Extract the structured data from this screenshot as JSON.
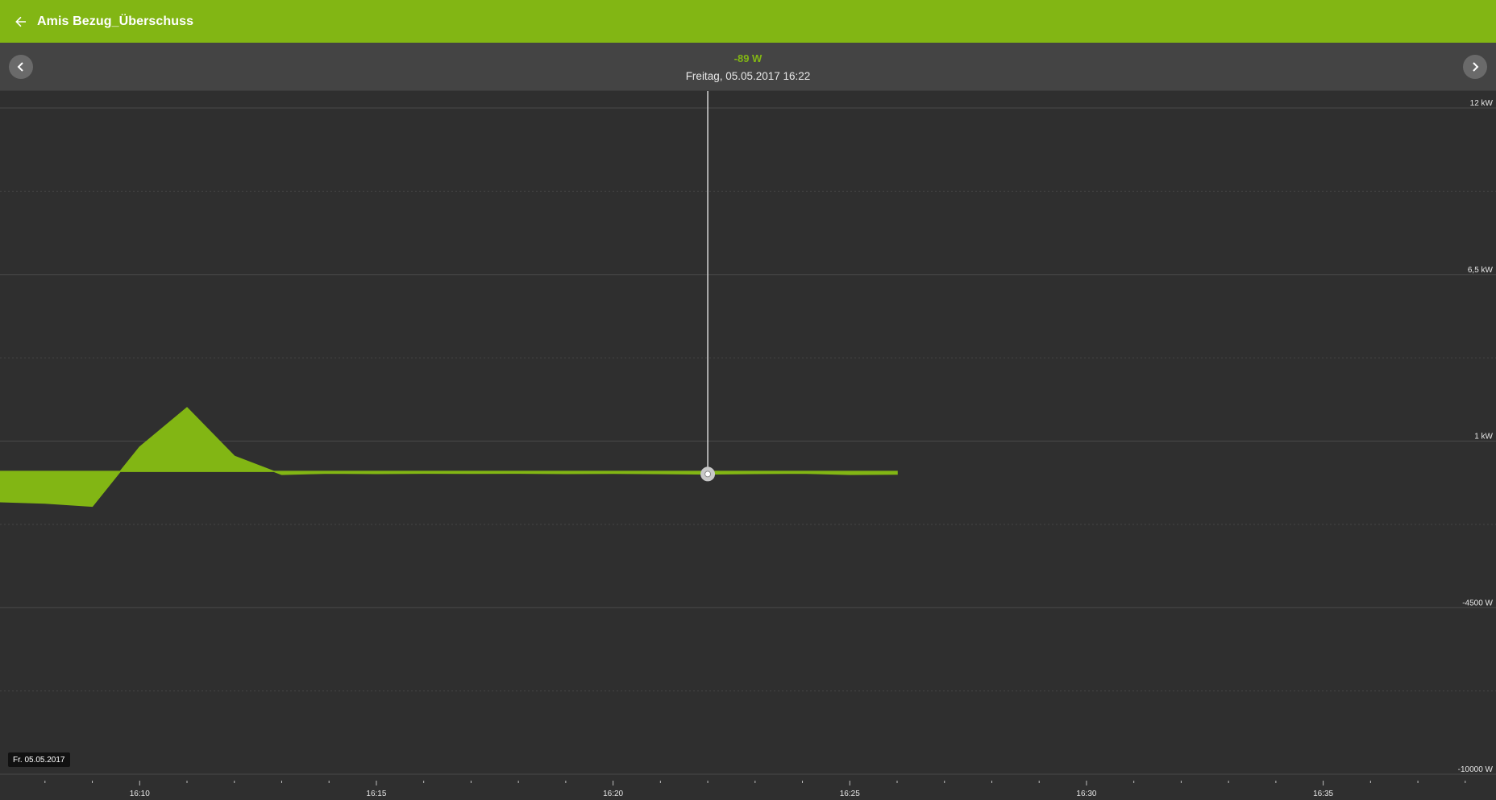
{
  "appbar": {
    "title": "Amis Bezug_Überschuss",
    "back_icon": "arrow-left-icon",
    "background": "#82b614"
  },
  "infobar": {
    "value": "-89 W",
    "datetime": "Freitag, 05.05.2017 16:22",
    "prev_icon": "chevron-left-icon",
    "next_icon": "chevron-right-icon",
    "value_color": "#82b614"
  },
  "date_chip": "Fr. 05.05.2017",
  "chart_data": {
    "type": "area",
    "y_unit": "W",
    "ylim": [
      -10000,
      12000
    ],
    "y_ticks": [
      {
        "value": 12000,
        "label": "12  kW"
      },
      {
        "value": 6500,
        "label": "6,5  kW"
      },
      {
        "value": 1000,
        "label": "1  kW"
      },
      {
        "value": -4500,
        "label": "-4500  W"
      },
      {
        "value": -10000,
        "label": "-10000  W"
      }
    ],
    "x_ticks": [
      {
        "minute": 10,
        "label": "16:10"
      },
      {
        "minute": 15,
        "label": "16:15"
      },
      {
        "minute": 20,
        "label": "16:20"
      },
      {
        "minute": 25,
        "label": "16:25"
      },
      {
        "minute": 30,
        "label": "16:30"
      },
      {
        "minute": 35,
        "label": "16:35"
      }
    ],
    "x_range_minutes": [
      7.05,
      38.65
    ],
    "x_time_base": "16:00",
    "series": [
      {
        "color": "#82b614",
        "points": [
          {
            "t": "16:07",
            "y": -1000
          },
          {
            "t": "16:08",
            "y": -1050
          },
          {
            "t": "16:09",
            "y": -1150
          },
          {
            "t": "16:10",
            "y": 800
          },
          {
            "t": "16:11",
            "y": 2100
          },
          {
            "t": "16:12",
            "y": 500
          },
          {
            "t": "16:13",
            "y": -100
          },
          {
            "t": "16:14",
            "y": -60
          },
          {
            "t": "16:15",
            "y": -70
          },
          {
            "t": "16:16",
            "y": -60
          },
          {
            "t": "16:17",
            "y": -65
          },
          {
            "t": "16:18",
            "y": -60
          },
          {
            "t": "16:19",
            "y": -70
          },
          {
            "t": "16:20",
            "y": -65
          },
          {
            "t": "16:21",
            "y": -75
          },
          {
            "t": "16:22",
            "y": -89
          },
          {
            "t": "16:23",
            "y": -70
          },
          {
            "t": "16:24",
            "y": -60
          },
          {
            "t": "16:25",
            "y": -100
          },
          {
            "t": "16:26",
            "y": -90
          }
        ]
      }
    ],
    "cursor": {
      "t": "16:22",
      "y": -89
    },
    "grid": true,
    "background": "#2f2f2f"
  }
}
